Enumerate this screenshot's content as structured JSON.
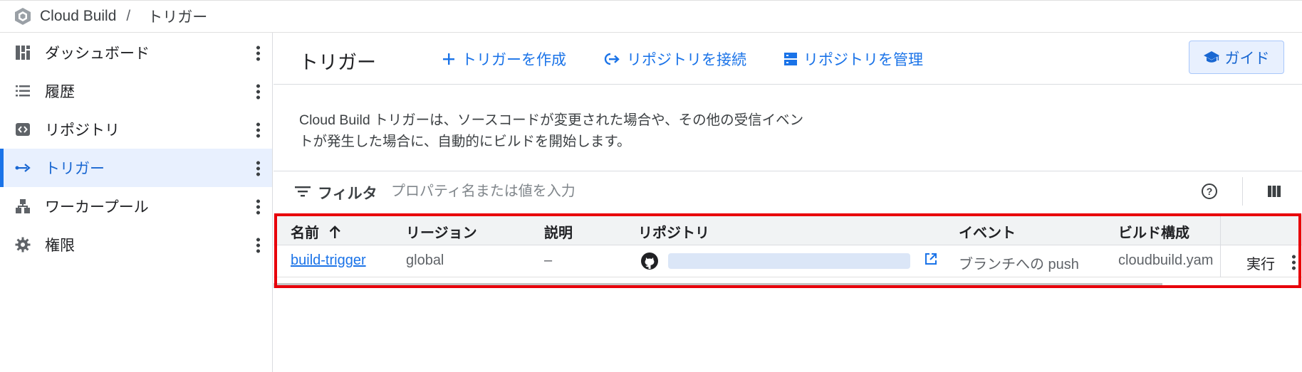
{
  "breadcrumb": {
    "product": "Cloud Build",
    "separator": "/",
    "page": "トリガー"
  },
  "sidebar": {
    "items": [
      {
        "label": "ダッシュボード",
        "icon": "dashboard-icon"
      },
      {
        "label": "履歴",
        "icon": "list-icon"
      },
      {
        "label": "リポジトリ",
        "icon": "code-icon"
      },
      {
        "label": "トリガー",
        "icon": "arrow-right-icon",
        "active": true
      },
      {
        "label": "ワーカープール",
        "icon": "worker-pool-icon"
      },
      {
        "label": "権限",
        "icon": "gear-icon"
      }
    ]
  },
  "header": {
    "title": "トリガー",
    "actions": {
      "create": "トリガーを作成",
      "connect": "リポジトリを接続",
      "manage": "リポジトリを管理"
    },
    "guide": "ガイド"
  },
  "description": {
    "line1": "Cloud Build トリガーは、ソースコードが変更された場合や、その他の受信イベン",
    "line2": "トが発生した場合に、自動的にビルドを開始します。"
  },
  "filter": {
    "label": "フィルタ",
    "placeholder": "プロパティ名または値を入力"
  },
  "table": {
    "columns": {
      "name": "名前",
      "region": "リージョン",
      "description": "説明",
      "repository": "リポジトリ",
      "event": "イベント",
      "build_config": "ビルド構成"
    },
    "sort": {
      "column": "name",
      "direction": "ascending"
    },
    "rows": [
      {
        "name": "build-trigger",
        "region": "global",
        "description": "–",
        "event": "ブランチへの push",
        "build_config": "cloudbuild.yam",
        "run": "実行"
      }
    ]
  },
  "colors": {
    "accent": "#1a73e8",
    "active_bg": "#e8f0fe",
    "highlight": "#e8000a"
  }
}
